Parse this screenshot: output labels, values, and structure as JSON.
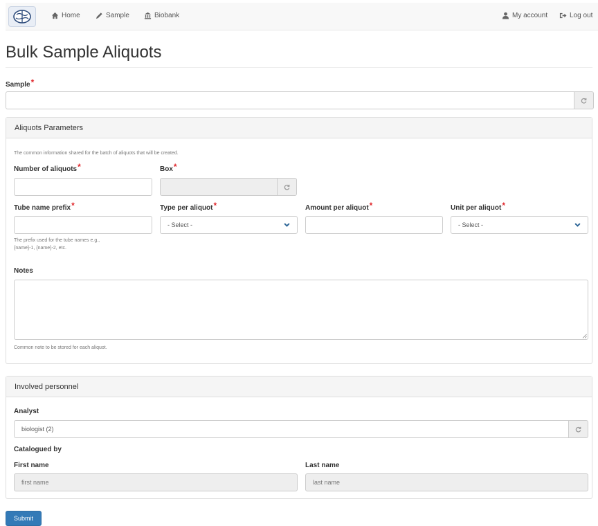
{
  "nav": {
    "home": "Home",
    "sample": "Sample",
    "biobank": "Biobank",
    "my_account": "My account",
    "log_out": "Log out"
  },
  "page": {
    "title": "Bulk Sample Aliquots",
    "required_marker": "*"
  },
  "sample": {
    "label": "Sample",
    "value": ""
  },
  "aliquots_panel": {
    "heading": "Aliquots Parameters",
    "intro": "The common information shared for the batch of aliquots that will be created.",
    "number_label": "Number of aliquots",
    "number_value": "",
    "box_label": "Box",
    "box_value": "",
    "prefix_label": "Tube name prefix",
    "prefix_value": "",
    "prefix_help_line1": "The prefix used for the tube names e.g.,",
    "prefix_help_line2": "{name}-1, {name}-2, etc.",
    "type_label": "Type per aliquot",
    "type_selected": "- Select -",
    "amount_label": "Amount per aliquot",
    "amount_value": "",
    "unit_label": "Unit per aliquot",
    "unit_selected": "- Select -",
    "notes_label": "Notes",
    "notes_value": "",
    "notes_help": "Common note to be stored for each aliquot."
  },
  "personnel_panel": {
    "heading": "Involved personnel",
    "analyst_label": "Analyst",
    "analyst_value": "biologist (2)",
    "catalogued_label": "Catalogued by",
    "first_name_label": "First name",
    "first_name_placeholder": "first name",
    "last_name_label": "Last name",
    "last_name_placeholder": "last name"
  },
  "submit_label": "Submit",
  "colors": {
    "primary": "#337ab7",
    "required": "#e0262b",
    "select_arrow": "#2a6496"
  },
  "icons": [
    "brain-logo-icon",
    "home-icon",
    "pencil-icon",
    "bank-icon",
    "user-icon",
    "logout-icon",
    "refresh-icon",
    "chevron-down-icon",
    "resize-grip-icon"
  ]
}
